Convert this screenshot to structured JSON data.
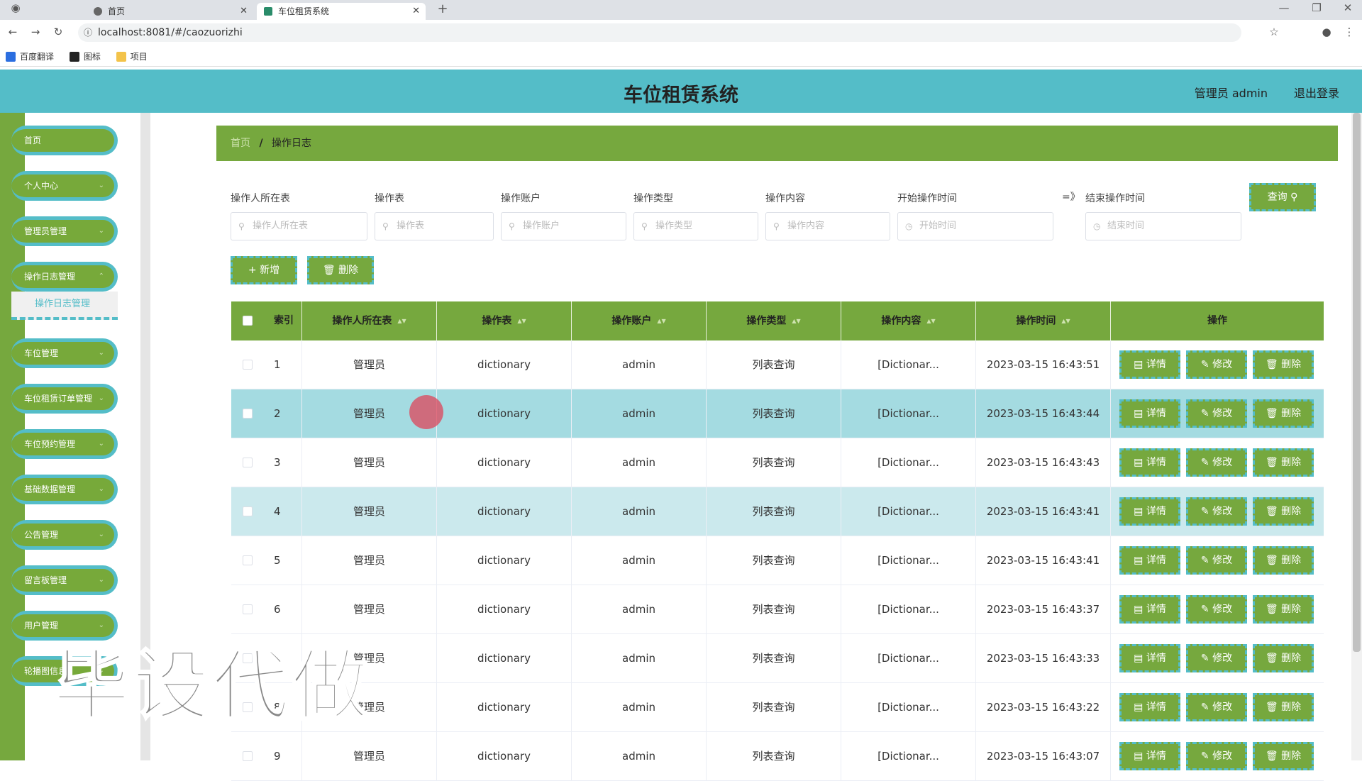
{
  "browser": {
    "tabs": [
      {
        "label": "首页"
      },
      {
        "label": "车位租赁系统"
      }
    ],
    "url": "localhost:8081/#/caozuorizhi",
    "bookmarks": [
      "百度翻译",
      "图标",
      "项目"
    ]
  },
  "header": {
    "title": "车位租赁系统",
    "user": "管理员 admin",
    "logout": "退出登录"
  },
  "sidebar": {
    "items": [
      "首页",
      "个人中心",
      "管理员管理",
      "操作日志管理",
      "车位管理",
      "车位租赁订单管理",
      "车位预约管理",
      "基础数据管理",
      "公告管理",
      "留言板管理",
      "用户管理",
      "轮播图信息"
    ],
    "active_sub": "操作日志管理"
  },
  "breadcrumb": {
    "home": "首页",
    "sep": "/",
    "current": "操作日志"
  },
  "filters": {
    "labels": [
      "操作人所在表",
      "操作表",
      "操作账户",
      "操作类型",
      "操作内容",
      "开始操作时间",
      "结束操作时间"
    ],
    "placeholders": [
      "操作人所在表",
      "操作表",
      "操作账户",
      "操作类型",
      "操作内容",
      "开始时间",
      "结束时间"
    ],
    "range_sep": "=》",
    "search": "查询"
  },
  "actions": {
    "add": "新增",
    "delete": "删除"
  },
  "table": {
    "headers": [
      "索引",
      "操作人所在表",
      "操作表",
      "操作账户",
      "操作类型",
      "操作内容",
      "操作时间",
      "操作"
    ],
    "row_buttons": [
      "详情",
      "修改",
      "删除"
    ],
    "rows": [
      [
        "1",
        "管理员",
        "dictionary",
        "admin",
        "列表查询",
        "[Dictionar...",
        "2023-03-15 16:43:51"
      ],
      [
        "2",
        "管理员",
        "dictionary",
        "admin",
        "列表查询",
        "[Dictionar...",
        "2023-03-15 16:43:44"
      ],
      [
        "3",
        "管理员",
        "dictionary",
        "admin",
        "列表查询",
        "[Dictionar...",
        "2023-03-15 16:43:43"
      ],
      [
        "4",
        "管理员",
        "dictionary",
        "admin",
        "列表查询",
        "[Dictionar...",
        "2023-03-15 16:43:41"
      ],
      [
        "5",
        "管理员",
        "dictionary",
        "admin",
        "列表查询",
        "[Dictionar...",
        "2023-03-15 16:43:41"
      ],
      [
        "6",
        "管理员",
        "dictionary",
        "admin",
        "列表查询",
        "[Dictionar...",
        "2023-03-15 16:43:37"
      ],
      [
        "7",
        "管理员",
        "dictionary",
        "admin",
        "列表查询",
        "[Dictionar...",
        "2023-03-15 16:43:33"
      ],
      [
        "8",
        "管理员",
        "dictionary",
        "admin",
        "列表查询",
        "[Dictionar...",
        "2023-03-15 16:43:22"
      ],
      [
        "9",
        "管理员",
        "dictionary",
        "admin",
        "列表查询",
        "[Dictionar...",
        "2023-03-15 16:43:07"
      ]
    ]
  },
  "watermark": "毕设代做",
  "colors": {
    "header": "#54bdc8",
    "accent": "#76a83e",
    "row_highlight": "#a4dbe1"
  }
}
